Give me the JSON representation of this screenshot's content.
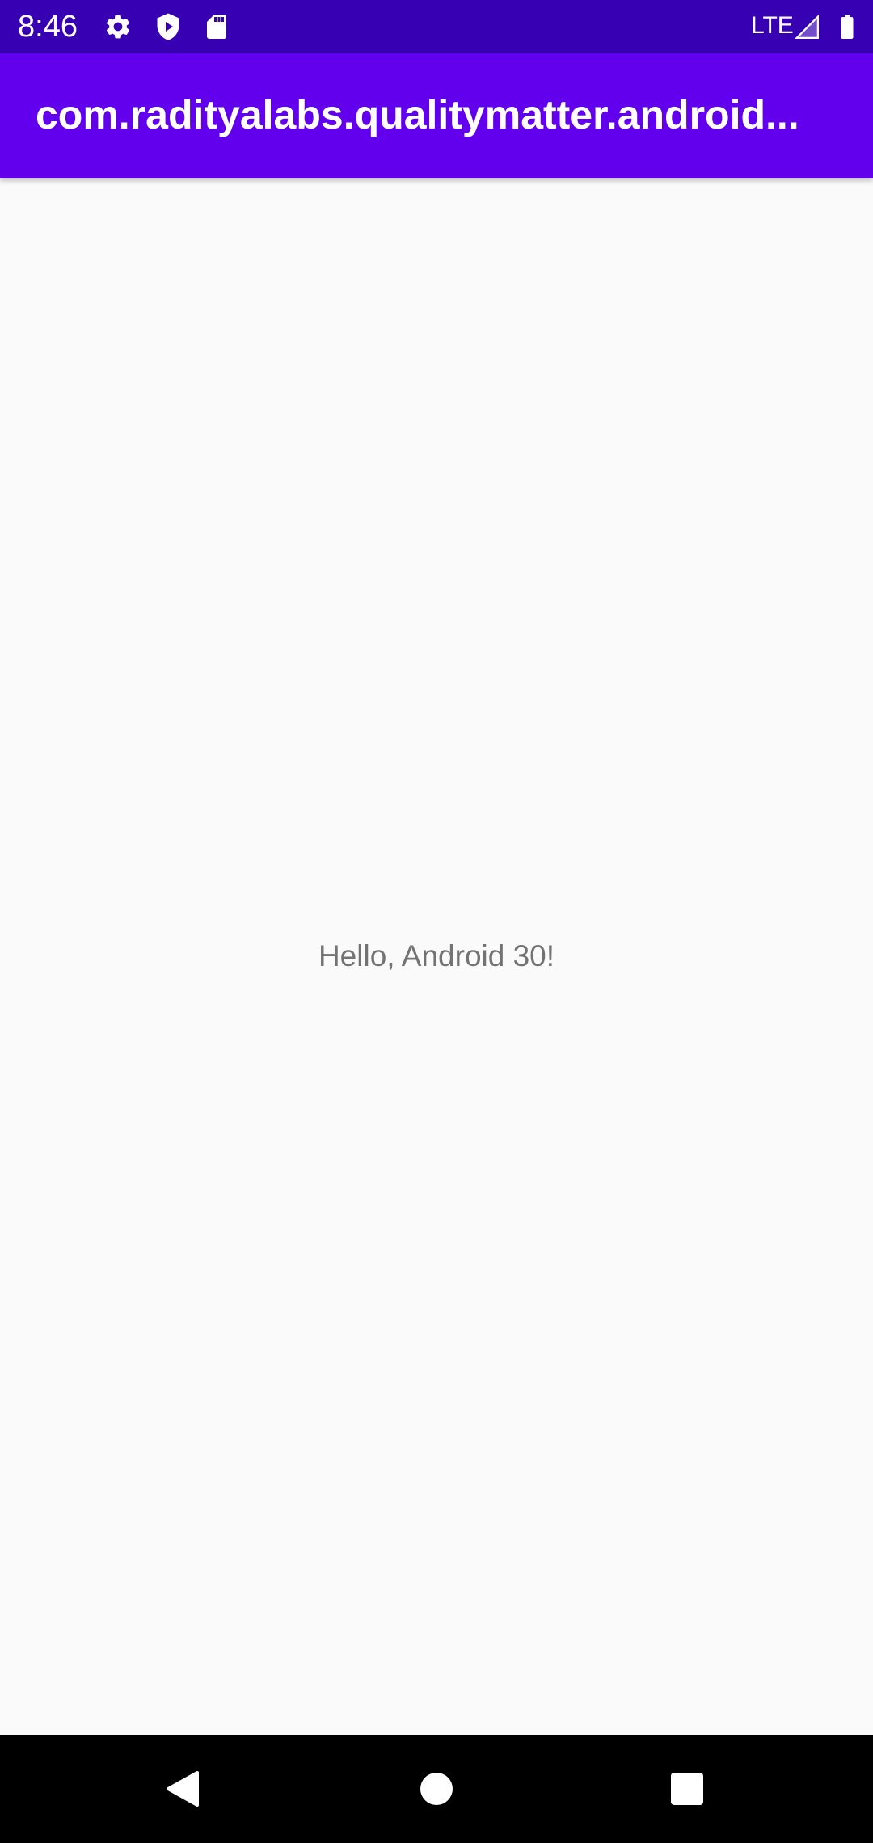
{
  "status_bar": {
    "time": "8:46",
    "icons": [
      "settings-icon",
      "shield-play-icon",
      "sd-card-icon"
    ],
    "network": "LTE",
    "signal_icon": "signal-icon",
    "battery_icon": "battery-icon"
  },
  "app_bar": {
    "title": "com.radityalabs.qualitymatter.android..."
  },
  "content": {
    "message": "Hello, Android 30!"
  },
  "nav_bar": {
    "buttons": [
      "back-icon",
      "home-icon",
      "recents-icon"
    ]
  },
  "colors": {
    "status_bar": "#3700b3",
    "app_bar": "#6200ee",
    "background": "#fafafa",
    "text": "#737373",
    "nav_bar": "#000000"
  }
}
